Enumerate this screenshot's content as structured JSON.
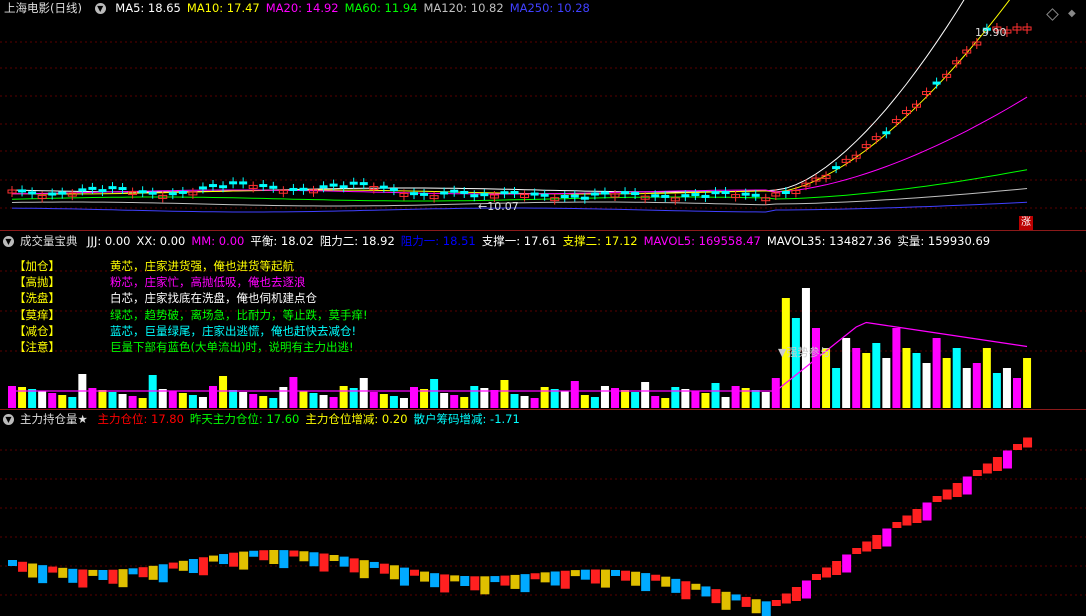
{
  "price_panel": {
    "title": "上海电影(日线)",
    "ma": [
      {
        "label": "MA5: 18.65",
        "color": "#ffffff"
      },
      {
        "label": "MA10: 17.47",
        "color": "#ffff00"
      },
      {
        "label": "MA20: 14.92",
        "color": "#ff00ff"
      },
      {
        "label": "MA60: 11.94",
        "color": "#00ff00"
      },
      {
        "label": "MA120: 10.82",
        "color": "#c0c0c0"
      },
      {
        "label": "MA250: 10.28",
        "color": "#4040ff"
      }
    ],
    "high_label": "19.90",
    "low_label": "10.07",
    "badge": "涨"
  },
  "volume_panel": {
    "title": "成交量宝典",
    "fields": [
      {
        "label": "JJJ: 0.00",
        "color": "#ffffff"
      },
      {
        "label": "XX: 0.00",
        "color": "#ffffff"
      },
      {
        "label": "MM: 0.00",
        "color": "#ff00ff"
      },
      {
        "label": "平衡: 18.02",
        "color": "#ffffff"
      },
      {
        "label": "阻力二: 18.92",
        "color": "#ffffff"
      },
      {
        "label": "阻力一: 18.51",
        "color": "#0000ff"
      },
      {
        "label": "支撑一: 17.61",
        "color": "#ffffff"
      },
      {
        "label": "支撑二: 17.12",
        "color": "#ffff00"
      },
      {
        "label": "MAVOL5: 169558.47",
        "color": "#ff00ff"
      },
      {
        "label": "MAVOL35: 134827.36",
        "color": "#ffffff"
      },
      {
        "label": "实量: 159930.69",
        "color": "#ffffff"
      }
    ],
    "legend": [
      {
        "tag": "【加仓】",
        "text": "黄芯，庄家进货强，俺也进货等起航",
        "color": "#ffff00"
      },
      {
        "tag": "【高抛】",
        "text": "粉芯，庄家忙，高抛低吸，俺也去逐浪",
        "color": "#ff00ff"
      },
      {
        "tag": "【洗盘】",
        "text": "白芯，庄家找底在洗盘，俺也伺机建点仓",
        "color": "#ffffff"
      },
      {
        "tag": "【莫痒】",
        "text": "绿芯，趋势破，离场急，比耐力，等止跌，莫手痒!",
        "color": "#00ff00"
      },
      {
        "tag": "【减仓】",
        "text": "蓝芯，巨量绿尾，庄家出逃慌，俺也赶快去减仓!",
        "color": "#00ffff"
      },
      {
        "tag": "【注意】",
        "text": "巨量下部有蓝色(大单流出)时，说明有主力出逃!",
        "color": "#00ff00"
      }
    ],
    "marker": "▼强势参与"
  },
  "holding_panel": {
    "title": "主力持仓量★",
    "fields": [
      {
        "label": "主力仓位: 17.80",
        "color": "#ff0000"
      },
      {
        "label": "昨天主力仓位: 17.60",
        "color": "#00ff00"
      },
      {
        "label": "主力仓位增减: 0.20",
        "color": "#ffff00"
      },
      {
        "label": "散户筹码增减: -1.71",
        "color": "#00ffff"
      }
    ]
  },
  "chart_data": [
    {
      "type": "line",
      "title": "上海电影(日线)",
      "series_note": "candlestick price panel",
      "ylim": [
        10.07,
        19.9
      ]
    }
  ]
}
